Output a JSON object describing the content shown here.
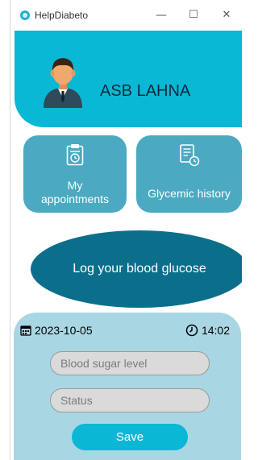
{
  "window": {
    "title": "HelpDiabeto",
    "controls": {
      "minimize": "—",
      "maximize": "☐",
      "close": "✕"
    }
  },
  "header": {
    "user_name": "ASB LAHNA",
    "avatar_icon": "doctor-avatar-icon"
  },
  "cards": [
    {
      "label_line1": "My",
      "label_line2": "appointments",
      "icon": "calendar-clock-icon"
    },
    {
      "label": "Glycemic history",
      "icon": "document-clock-icon"
    }
  ],
  "main_action": {
    "label": "Log your blood glucose"
  },
  "form": {
    "date": "2023-10-05",
    "time": "14:02",
    "blood_sugar_placeholder": "Blood sugar level",
    "status_placeholder": "Status",
    "save_label": "Save"
  },
  "colors": {
    "header": "#08b8d5",
    "card": "#4ba9c2",
    "oval": "#0b6f8b",
    "panel": "#a9d6e3",
    "save": "#0ab8d6"
  }
}
